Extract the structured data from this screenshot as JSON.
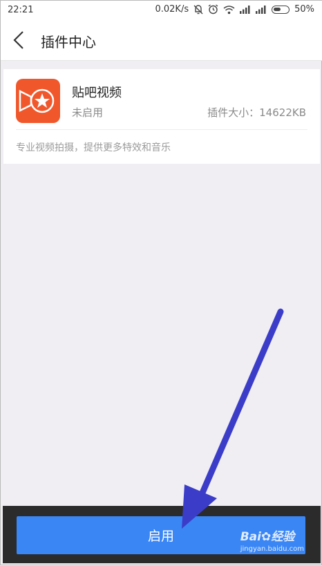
{
  "status_bar": {
    "time": "22:21",
    "net_speed": "0.02K/s",
    "battery": "50%",
    "icons": [
      "bell-off-icon",
      "alarm-icon",
      "wifi-icon",
      "signal-icon",
      "signal-icon",
      "battery-icon"
    ]
  },
  "header": {
    "title": "插件中心",
    "back_icon": "chevron-left-icon"
  },
  "plugin": {
    "name": "贴吧视频",
    "status": "未启用",
    "size": "插件大小：14622KB",
    "description": "专业视频拍摄，提供更多特效和音乐",
    "icon_color": "#f0582c"
  },
  "bottom": {
    "enable_label": "启用",
    "button_color": "#3a86f5"
  },
  "watermark": {
    "brand": "Bai",
    "brand_suffix": "经验",
    "site": "jingyan.baidu.com"
  },
  "annotation": {
    "arrow_color": "#3b3dc9"
  }
}
